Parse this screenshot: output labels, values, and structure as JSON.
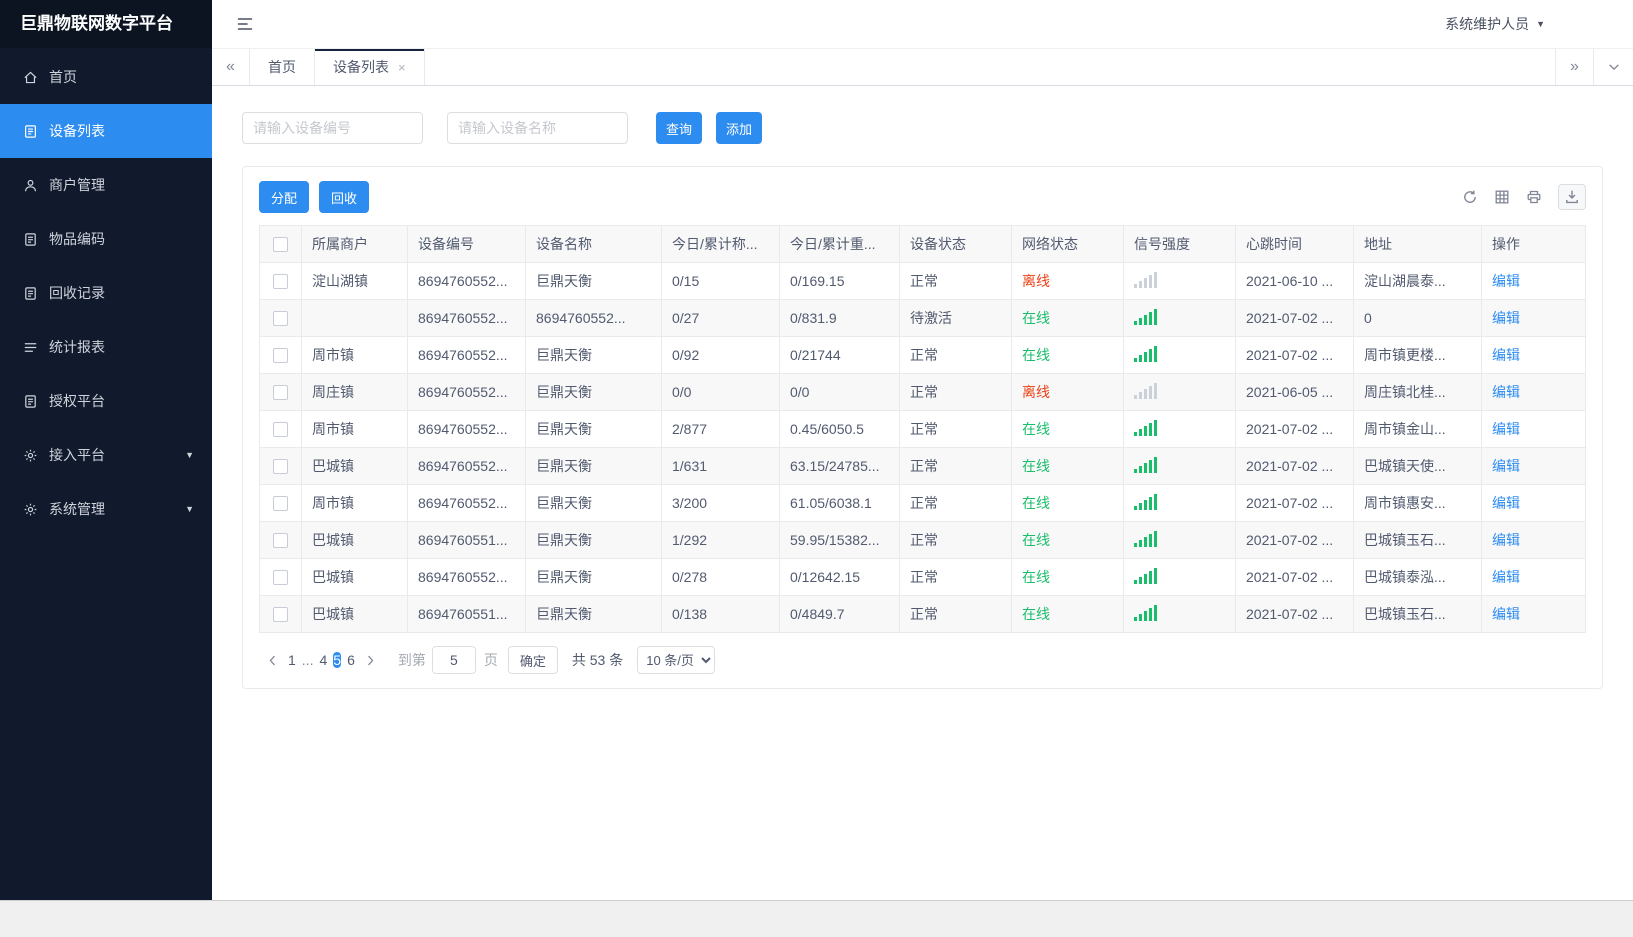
{
  "app": {
    "title": "巨鼎物联网数字平台",
    "user": "系统维护人员"
  },
  "colors": {
    "primary": "#2d8cf0",
    "online": "#19be6b",
    "offline": "#ed4014",
    "sidebar_bg": "#101a2c"
  },
  "sidebar": {
    "items": [
      {
        "name": "home",
        "icon": "home-icon",
        "label": "首页",
        "active": false,
        "expandable": false
      },
      {
        "name": "device-list",
        "icon": "device-list-icon",
        "label": "设备列表",
        "active": true,
        "expandable": false
      },
      {
        "name": "merchant-management",
        "icon": "merchant-icon",
        "label": "商户管理",
        "active": false,
        "expandable": false
      },
      {
        "name": "item-coding",
        "icon": "document-icon",
        "label": "物品编码",
        "active": false,
        "expandable": false
      },
      {
        "name": "recycle-records",
        "icon": "document-icon",
        "label": "回收记录",
        "active": false,
        "expandable": false
      },
      {
        "name": "statistics-report",
        "icon": "report-icon",
        "label": "统计报表",
        "active": false,
        "expandable": false
      },
      {
        "name": "authorization-platform",
        "icon": "document-icon",
        "label": "授权平台",
        "active": false,
        "expandable": false
      },
      {
        "name": "access-platform",
        "icon": "gear-icon",
        "label": "接入平台",
        "active": false,
        "expandable": true
      },
      {
        "name": "system-management",
        "icon": "gear-icon",
        "label": "系统管理",
        "active": false,
        "expandable": true
      }
    ]
  },
  "tabs": [
    {
      "name": "home",
      "label": "首页",
      "active": false,
      "closable": false
    },
    {
      "name": "device-list",
      "label": "设备列表",
      "active": true,
      "closable": true
    }
  ],
  "search": {
    "device_no_placeholder": "请输入设备编号",
    "device_name_placeholder": "请输入设备名称",
    "query_label": "查询",
    "add_label": "添加"
  },
  "toolbar": {
    "allocate_label": "分配",
    "recycle_label": "回收",
    "icons": [
      "refresh-icon",
      "column-settings-icon",
      "printer-icon",
      "export-icon"
    ]
  },
  "table": {
    "columns": [
      "所属商户",
      "设备编号",
      "设备名称",
      "今日/累计称...",
      "今日/累计重...",
      "设备状态",
      "网络状态",
      "信号强度",
      "心跳时间",
      "地址",
      "操作"
    ],
    "edit_label": "编辑",
    "rows": [
      {
        "merchant": "淀山湖镇",
        "device_no": "8694760552...",
        "device_name": "巨鼎天衡",
        "count": "0/15",
        "weight": "0/169.15",
        "status": "正常",
        "network": "离线",
        "network_state": "offline",
        "signal": "weak",
        "heartbeat": "2021-06-10 ...",
        "address": "淀山湖晨泰..."
      },
      {
        "merchant": "",
        "device_no": "8694760552...",
        "device_name": "8694760552...",
        "count": "0/27",
        "weight": "0/831.9",
        "status": "待激活",
        "network": "在线",
        "network_state": "online",
        "signal": "strong",
        "heartbeat": "2021-07-02 ...",
        "address": "0"
      },
      {
        "merchant": "周市镇",
        "device_no": "8694760552...",
        "device_name": "巨鼎天衡",
        "count": "0/92",
        "weight": "0/21744",
        "status": "正常",
        "network": "在线",
        "network_state": "online",
        "signal": "strong",
        "heartbeat": "2021-07-02 ...",
        "address": "周市镇更楼..."
      },
      {
        "merchant": "周庄镇",
        "device_no": "8694760552...",
        "device_name": "巨鼎天衡",
        "count": "0/0",
        "weight": "0/0",
        "status": "正常",
        "network": "离线",
        "network_state": "offline",
        "signal": "weak",
        "heartbeat": "2021-06-05 ...",
        "address": "周庄镇北桂..."
      },
      {
        "merchant": "周市镇",
        "device_no": "8694760552...",
        "device_name": "巨鼎天衡",
        "count": "2/877",
        "weight": "0.45/6050.5",
        "status": "正常",
        "network": "在线",
        "network_state": "online",
        "signal": "strong",
        "heartbeat": "2021-07-02 ...",
        "address": "周市镇金山..."
      },
      {
        "merchant": "巴城镇",
        "device_no": "8694760552...",
        "device_name": "巨鼎天衡",
        "count": "1/631",
        "weight": "63.15/24785...",
        "status": "正常",
        "network": "在线",
        "network_state": "online",
        "signal": "strong",
        "heartbeat": "2021-07-02 ...",
        "address": "巴城镇天使..."
      },
      {
        "merchant": "周市镇",
        "device_no": "8694760552...",
        "device_name": "巨鼎天衡",
        "count": "3/200",
        "weight": "61.05/6038.1",
        "status": "正常",
        "network": "在线",
        "network_state": "online",
        "signal": "strong",
        "heartbeat": "2021-07-02 ...",
        "address": "周市镇惠安..."
      },
      {
        "merchant": "巴城镇",
        "device_no": "8694760551...",
        "device_name": "巨鼎天衡",
        "count": "1/292",
        "weight": "59.95/15382...",
        "status": "正常",
        "network": "在线",
        "network_state": "online",
        "signal": "strong",
        "heartbeat": "2021-07-02 ...",
        "address": "巴城镇玉石..."
      },
      {
        "merchant": "巴城镇",
        "device_no": "8694760552...",
        "device_name": "巨鼎天衡",
        "count": "0/278",
        "weight": "0/12642.15",
        "status": "正常",
        "network": "在线",
        "network_state": "online",
        "signal": "strong",
        "heartbeat": "2021-07-02 ...",
        "address": "巴城镇泰泓..."
      },
      {
        "merchant": "巴城镇",
        "device_no": "8694760551...",
        "device_name": "巨鼎天衡",
        "count": "0/138",
        "weight": "0/4849.7",
        "status": "正常",
        "network": "在线",
        "network_state": "online",
        "signal": "strong",
        "heartbeat": "2021-07-02 ...",
        "address": "巴城镇玉石..."
      }
    ]
  },
  "pagination": {
    "pages": [
      {
        "label": "1",
        "type": "page",
        "active": false
      },
      {
        "label": "...",
        "type": "ellipsis",
        "active": false
      },
      {
        "label": "4",
        "type": "page",
        "active": false
      },
      {
        "label": "5",
        "type": "page",
        "active": true
      },
      {
        "label": "6",
        "type": "page",
        "active": false
      }
    ],
    "goto_label": "到第",
    "goto_value": "5",
    "unit_label": "页",
    "confirm_label": "确定",
    "total_label": "共 53 条",
    "page_size_label": "10 条/页"
  }
}
